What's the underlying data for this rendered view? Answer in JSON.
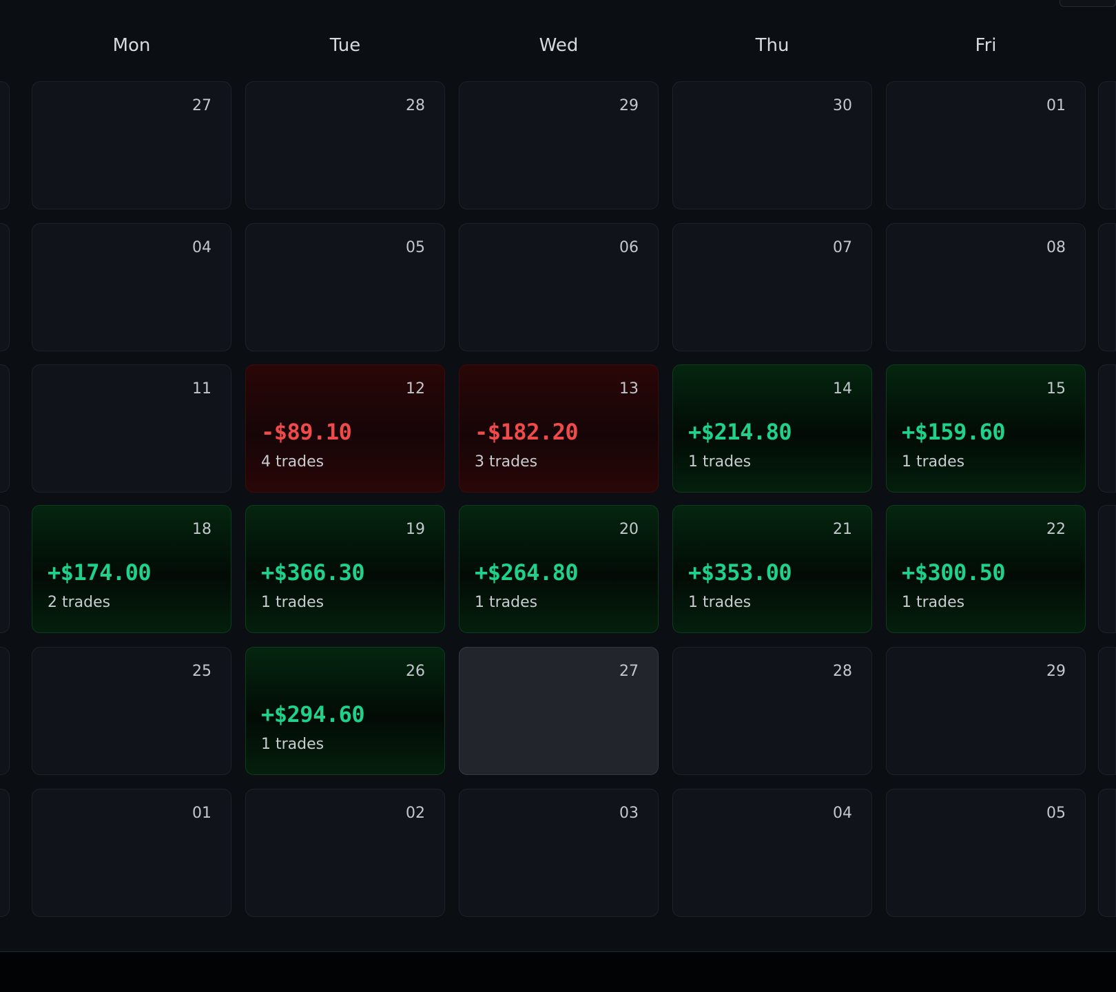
{
  "weekdays": [
    "Mon",
    "Tue",
    "Wed",
    "Thu",
    "Fri"
  ],
  "weeks": [
    [
      {
        "date": "27",
        "pnl": "",
        "trades": "",
        "status": "empty"
      },
      {
        "date": "28",
        "pnl": "",
        "trades": "",
        "status": "empty"
      },
      {
        "date": "29",
        "pnl": "",
        "trades": "",
        "status": "empty"
      },
      {
        "date": "30",
        "pnl": "",
        "trades": "",
        "status": "empty"
      },
      {
        "date": "01",
        "pnl": "",
        "trades": "",
        "status": "empty"
      }
    ],
    [
      {
        "date": "04",
        "pnl": "",
        "trades": "",
        "status": "empty"
      },
      {
        "date": "05",
        "pnl": "",
        "trades": "",
        "status": "empty"
      },
      {
        "date": "06",
        "pnl": "",
        "trades": "",
        "status": "empty"
      },
      {
        "date": "07",
        "pnl": "",
        "trades": "",
        "status": "empty"
      },
      {
        "date": "08",
        "pnl": "",
        "trades": "",
        "status": "empty"
      }
    ],
    [
      {
        "date": "11",
        "pnl": "",
        "trades": "",
        "status": "empty"
      },
      {
        "date": "12",
        "pnl": "-$89.10",
        "trades": "4 trades",
        "status": "loss"
      },
      {
        "date": "13",
        "pnl": "-$182.20",
        "trades": "3 trades",
        "status": "loss"
      },
      {
        "date": "14",
        "pnl": "+$214.80",
        "trades": "1 trades",
        "status": "profit"
      },
      {
        "date": "15",
        "pnl": "+$159.60",
        "trades": "1 trades",
        "status": "profit"
      }
    ],
    [
      {
        "date": "18",
        "pnl": "+$174.00",
        "trades": "2 trades",
        "status": "profit"
      },
      {
        "date": "19",
        "pnl": "+$366.30",
        "trades": "1 trades",
        "status": "profit"
      },
      {
        "date": "20",
        "pnl": "+$264.80",
        "trades": "1 trades",
        "status": "profit"
      },
      {
        "date": "21",
        "pnl": "+$353.00",
        "trades": "1 trades",
        "status": "profit"
      },
      {
        "date": "22",
        "pnl": "+$300.50",
        "trades": "1 trades",
        "status": "profit"
      }
    ],
    [
      {
        "date": "25",
        "pnl": "",
        "trades": "",
        "status": "empty"
      },
      {
        "date": "26",
        "pnl": "+$294.60",
        "trades": "1 trades",
        "status": "profit"
      },
      {
        "date": "27",
        "pnl": "",
        "trades": "",
        "status": "today"
      },
      {
        "date": "28",
        "pnl": "",
        "trades": "",
        "status": "empty"
      },
      {
        "date": "29",
        "pnl": "",
        "trades": "",
        "status": "empty"
      }
    ],
    [
      {
        "date": "01",
        "pnl": "",
        "trades": "",
        "status": "empty"
      },
      {
        "date": "02",
        "pnl": "",
        "trades": "",
        "status": "empty"
      },
      {
        "date": "03",
        "pnl": "",
        "trades": "",
        "status": "empty"
      },
      {
        "date": "04",
        "pnl": "",
        "trades": "",
        "status": "empty"
      },
      {
        "date": "05",
        "pnl": "",
        "trades": "",
        "status": "empty"
      }
    ]
  ],
  "colors": {
    "profit": "#1fd18a",
    "loss": "#f04b4b",
    "background": "#0b0e13"
  }
}
